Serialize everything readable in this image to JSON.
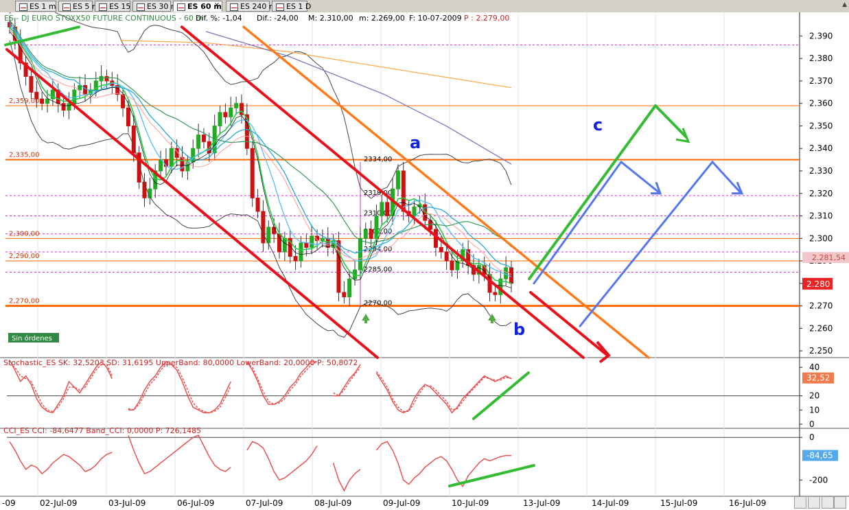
{
  "tabs": [
    {
      "label": "ES 1 m",
      "active": false
    },
    {
      "label": "ES 5 m",
      "active": false
    },
    {
      "label": "ES 15 m",
      "active": false
    },
    {
      "label": "ES 30 m",
      "active": false
    },
    {
      "label": "ES 60 m",
      "active": true
    },
    {
      "label": "ES 240 m",
      "active": false
    },
    {
      "label": "ES 1 D",
      "active": false
    }
  ],
  "info": {
    "prefix": "ES - DJ EURO STOXX50 FUTURE CONTINUOUS - 60 m",
    "dif": "Dif. %: -1,04",
    "dif_abs": "Dif.: -24,00",
    "max": "M: 2.310,00",
    "min": "m: 2.269,00",
    "date": "F: 10-07-2009",
    "price": "P : 2.279,00"
  },
  "annotations": {
    "a": "a",
    "b": "b",
    "c": "c"
  },
  "orders_label": "Sin órdenes",
  "colors": {
    "up": "#22aa22",
    "down": "#cc1111",
    "hline": "#ff6600",
    "dashed": "#cc33cc",
    "redChannel": "#e8101a",
    "orangeLine": "#ff7a1a",
    "green": "#33bb33",
    "blue": "#5577ee",
    "stoch": "#e85050",
    "stochBlue": "#3388dd",
    "cci": "#e85050",
    "priceBadge": "#ee2222",
    "stochBadge": "#f07a4a",
    "cciBadge": "#55aaee"
  },
  "chart_data": [
    {
      "type": "candlestick",
      "title": "ES - DJ EURO STOXX50 FUTURE CONTINUOUS - 60 m",
      "ylim": [
        2247,
        2395
      ],
      "y_ticks": [
        "2.390",
        "2.380",
        "2.370",
        "2.360",
        "2.350",
        "2.340",
        "2.330",
        "2.320",
        "2.310",
        "2.300",
        "2.290",
        "2.280",
        "2.270",
        "2.260",
        "2.250"
      ],
      "x_labels": [
        "-09",
        "02-Jul-09",
        "03-Jul-09",
        "06-Jul-09",
        "07-Jul-09",
        "08-Jul-09",
        "09-Jul-09",
        "10-Jul-09",
        "13-Jul-09",
        "14-Jul-09",
        "15-Jul-09",
        "16-Jul-09"
      ],
      "level_labels": [
        {
          "label": "2,359,00",
          "value": 2359
        },
        {
          "label": "2,335,00",
          "value": 2335
        },
        {
          "label": "2,300,00",
          "value": 2300
        },
        {
          "label": "2,290,00",
          "value": 2290
        },
        {
          "label": "2,270,00",
          "value": 2270
        }
      ],
      "fib_labels": [
        {
          "label": "2334,00",
          "value": 2334
        },
        {
          "label": "2319,00",
          "value": 2319
        },
        {
          "label": "2310,00",
          "value": 2310
        },
        {
          "label": "2302,00",
          "value": 2302
        },
        {
          "label": "2294,00",
          "value": 2294
        },
        {
          "label": "2285,00",
          "value": 2285
        },
        {
          "label": "2270,00",
          "value": 2270
        }
      ],
      "dashed_levels": [
        2386,
        2319,
        2310,
        2302,
        2294,
        2285
      ],
      "last_price": "2.280",
      "prev_badge": "2.281,54",
      "closes": [
        2394,
        2388,
        2378,
        2372,
        2365,
        2362,
        2360,
        2362,
        2366,
        2360,
        2357,
        2360,
        2366,
        2368,
        2364,
        2366,
        2370,
        2372,
        2370,
        2368,
        2364,
        2358,
        2350,
        2338,
        2325,
        2318,
        2322,
        2330,
        2335,
        2332,
        2340,
        2336,
        2330,
        2334,
        2340,
        2346,
        2343,
        2338,
        2350,
        2356,
        2354,
        2358,
        2360,
        2355,
        2340,
        2318,
        2312,
        2298,
        2305,
        2302,
        2294,
        2300,
        2292,
        2290,
        2298,
        2296,
        2301,
        2299,
        2300,
        2296,
        2299,
        2276,
        2274,
        2282,
        2286,
        2300,
        2304,
        2300,
        2310,
        2316,
        2310,
        2322,
        2330,
        2312,
        2310,
        2314,
        2315,
        2308,
        2304,
        2296,
        2294,
        2290,
        2286,
        2290,
        2295,
        2288,
        2284,
        2288,
        2284,
        2276,
        2275,
        2282,
        2287,
        2280
      ]
    },
    {
      "type": "line",
      "title": "Stochastic_ES SK: 32,5203 SD: 31,6195 UpperBand: 80,0000 LowerBand: 20,0000 P: 50,8072",
      "ylim": [
        0,
        42
      ],
      "y_ticks": [
        "40",
        "20",
        "10",
        "0"
      ],
      "badge": "32,52",
      "series": [
        {
          "name": "SK",
          "values": [
            45,
            38,
            30,
            34,
            28,
            18,
            12,
            9,
            8,
            14,
            20,
            30,
            26,
            22,
            28,
            34,
            40,
            44,
            40,
            32,
            20,
            12,
            10,
            10,
            16,
            24,
            30,
            34,
            40,
            44,
            42,
            38,
            30,
            20,
            12,
            10,
            8,
            8,
            10,
            14,
            22,
            30,
            36,
            42,
            44,
            38,
            30,
            20,
            14,
            14,
            16,
            20,
            26,
            30,
            36,
            40,
            44,
            44,
            38,
            28,
            20,
            20,
            26,
            32,
            36,
            42,
            44,
            40,
            36,
            30,
            24,
            16,
            10,
            8,
            10,
            18,
            24,
            28,
            26,
            22,
            18,
            14,
            8,
            12,
            18,
            22,
            26,
            30,
            34,
            32,
            30,
            32,
            34,
            32
          ]
        },
        {
          "name": "SD",
          "values": [
            42,
            40,
            34,
            32,
            30,
            22,
            14,
            10,
            9,
            12,
            18,
            26,
            26,
            24,
            26,
            32,
            38,
            42,
            42,
            34,
            24,
            14,
            11,
            10,
            14,
            21,
            28,
            32,
            38,
            42,
            42,
            40,
            33,
            24,
            15,
            11,
            9,
            8,
            9,
            12,
            19,
            27,
            33,
            40,
            43,
            40,
            32,
            23,
            16,
            14,
            15,
            18,
            24,
            28,
            34,
            38,
            42,
            44,
            40,
            31,
            22,
            20,
            24,
            30,
            35,
            40,
            43,
            41,
            37,
            32,
            26,
            18,
            12,
            9,
            9,
            15,
            22,
            27,
            27,
            24,
            20,
            16,
            10,
            11,
            16,
            21,
            25,
            29,
            33,
            32,
            31,
            31,
            33,
            32
          ]
        }
      ]
    },
    {
      "type": "line",
      "title": "CCI_ES CCI: -84,6477 Band_CCI: 0,0000 P: 726,1485",
      "ylim": [
        -260,
        20
      ],
      "y_ticks": [
        "0",
        "-200"
      ],
      "badge": "-84,65",
      "series": [
        {
          "name": "CCI",
          "values": [
            -20,
            -60,
            -110,
            -150,
            -130,
            -140,
            -170,
            -150,
            -120,
            -100,
            -80,
            -90,
            -110,
            -130,
            -160,
            -150,
            -130,
            -100,
            -80,
            -70,
            -40,
            -10,
            10,
            -60,
            -120,
            -170,
            -160,
            -140,
            -120,
            -100,
            -80,
            -60,
            -40,
            -20,
            0,
            10,
            -40,
            -90,
            -130,
            -150,
            -160,
            -140,
            -120,
            -100,
            -60,
            -20,
            -30,
            -50,
            -100,
            -160,
            -200,
            -190,
            -170,
            -150,
            -130,
            -110,
            -80,
            -40,
            -20,
            -10,
            -120,
            -200,
            -250,
            -200,
            -170,
            -150,
            -110,
            -80,
            -60,
            -30,
            -20,
            -60,
            -120,
            -200,
            -220,
            -190,
            -170,
            -140,
            -120,
            -100,
            -90,
            -110,
            -150,
            -200,
            -230,
            -180,
            -150,
            -120,
            -100,
            -110,
            -100,
            -90,
            -85,
            -85
          ]
        }
      ]
    }
  ]
}
